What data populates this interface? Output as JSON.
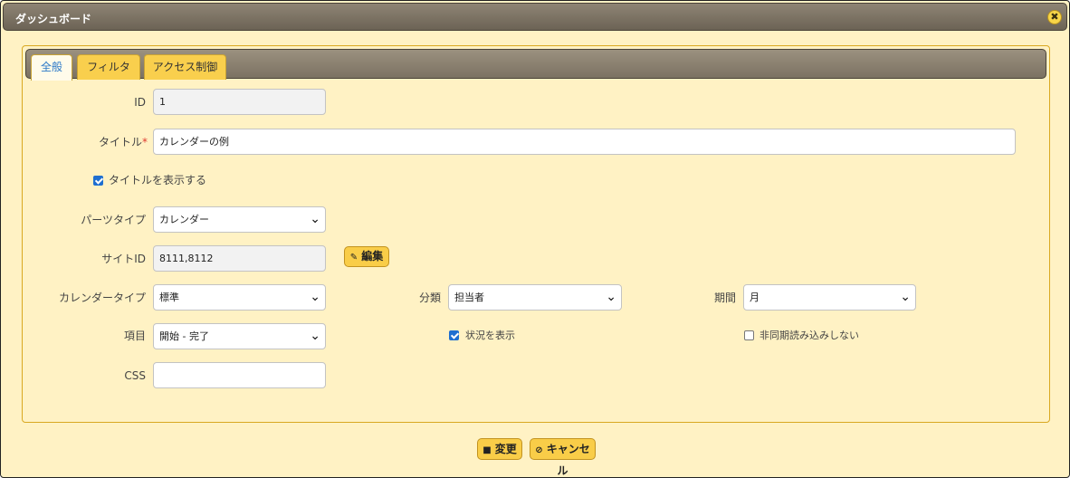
{
  "window": {
    "title": "ダッシュボード",
    "close_icon": "close-icon"
  },
  "tabs": [
    {
      "label": "全般",
      "active": true
    },
    {
      "label": "フィルタ",
      "active": false
    },
    {
      "label": "アクセス制御",
      "active": false
    }
  ],
  "form": {
    "id": {
      "label": "ID",
      "value": "1"
    },
    "title": {
      "label": "タイトル",
      "required_mark": "*",
      "value": "カレンダーの例"
    },
    "show_title": {
      "label": "タイトルを表示する",
      "checked": true
    },
    "parts_type": {
      "label": "パーツタイプ",
      "value": "カレンダー"
    },
    "site_id": {
      "label": "サイトID",
      "value": "8111,8112",
      "edit_label": "編集"
    },
    "calendar_type": {
      "label": "カレンダータイプ",
      "value": "標準"
    },
    "group": {
      "label": "分類",
      "value": "担当者"
    },
    "period": {
      "label": "期間",
      "value": "月"
    },
    "item": {
      "label": "項目",
      "value": "開始 - 完了"
    },
    "show_status": {
      "label": "状況を表示",
      "checked": true
    },
    "no_async": {
      "label": "非同期読み込みしない",
      "checked": false
    },
    "css": {
      "label": "CSS",
      "value": ""
    }
  },
  "footer": {
    "change_label": "変更",
    "cancel_label": "キャンセル"
  },
  "colors": {
    "background": "#fff2c4",
    "accent": "#f9cd48",
    "active_tab_text": "#2a78c8"
  }
}
